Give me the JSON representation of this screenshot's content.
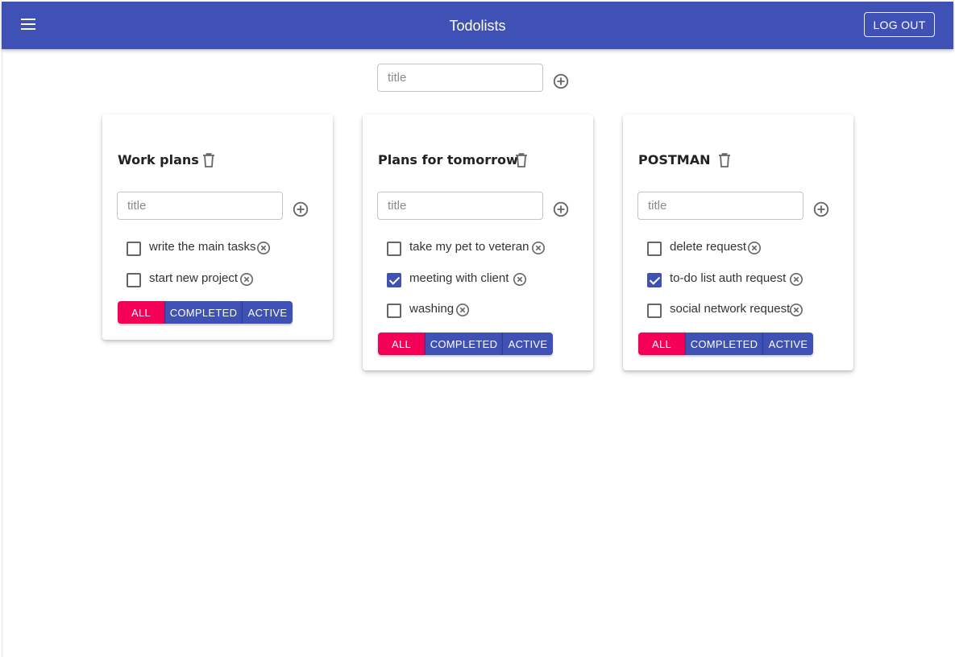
{
  "appbar": {
    "title": "Todolists",
    "logout_label": "LOG OUT"
  },
  "new_list": {
    "placeholder": "title"
  },
  "filter_labels": {
    "all": "ALL",
    "completed": "COMPLETED",
    "active": "ACTIVE"
  },
  "colors": {
    "primary": "#3f51b5",
    "secondary": "#f50057"
  },
  "lists": [
    {
      "title": "Work plans",
      "input_placeholder": "title",
      "tasks": [
        {
          "label": "write the main tasks",
          "done": false
        },
        {
          "label": "start new project",
          "done": false
        }
      ]
    },
    {
      "title": "Plans for tomorrow",
      "input_placeholder": "title",
      "tasks": [
        {
          "label": "take my pet to veteran",
          "done": false
        },
        {
          "label": "meeting with client",
          "done": true
        },
        {
          "label": "washing",
          "done": false
        }
      ]
    },
    {
      "title": "POSTMAN",
      "input_placeholder": "title",
      "tasks": [
        {
          "label": "delete request",
          "done": false
        },
        {
          "label": "to-do list auth request",
          "done": true
        },
        {
          "label": "social network request",
          "done": false
        }
      ]
    }
  ]
}
